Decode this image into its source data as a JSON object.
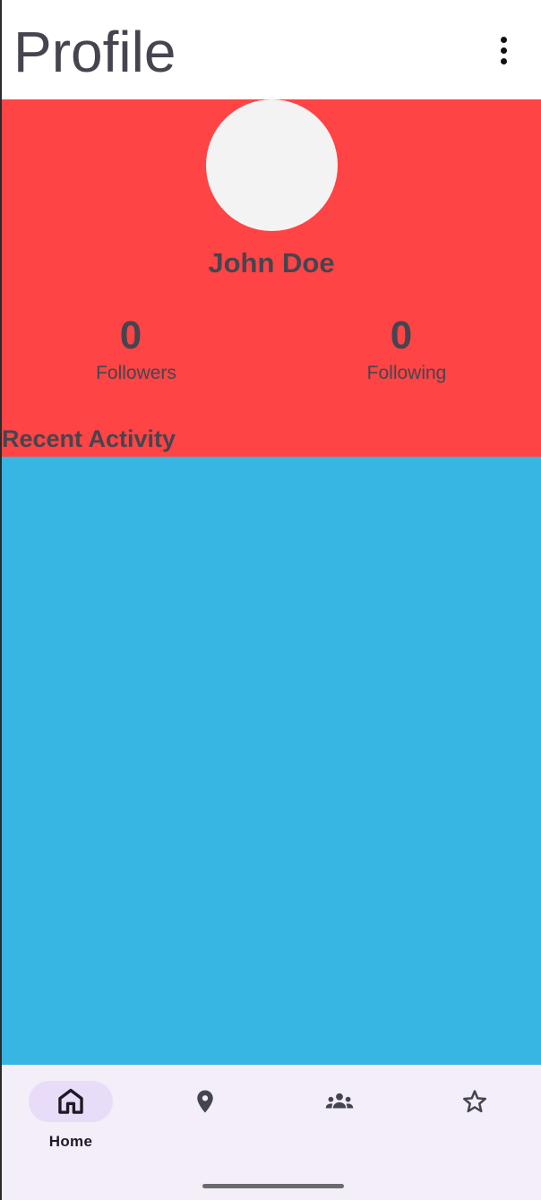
{
  "app_bar": {
    "title": "Profile",
    "menu_icon": "more-vert-icon"
  },
  "profile": {
    "name": "John Doe",
    "avatar_color": "#f3f3f3",
    "header_color": "#fe4445",
    "followers": {
      "count": "0",
      "label": "Followers"
    },
    "following": {
      "count": "0",
      "label": "Following"
    }
  },
  "activity": {
    "section_title": "Recent Activity",
    "background_color": "#37b5e3"
  },
  "bottom_nav": {
    "background_color": "#f3eef7",
    "items": [
      {
        "icon": "home-icon",
        "label": "Home",
        "active": true
      },
      {
        "icon": "location-pin-icon",
        "label": "",
        "active": false
      },
      {
        "icon": "groups-icon",
        "label": "",
        "active": false
      },
      {
        "icon": "star-icon",
        "label": "",
        "active": false
      }
    ]
  }
}
